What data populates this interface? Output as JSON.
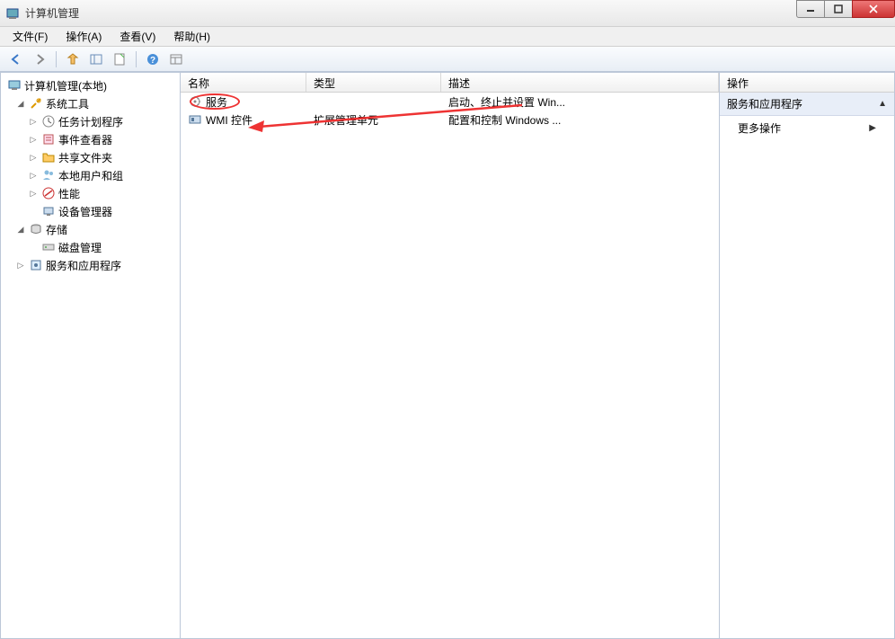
{
  "window": {
    "title": "计算机管理"
  },
  "menu": {
    "file": "文件(F)",
    "action": "操作(A)",
    "view": "查看(V)",
    "help": "帮助(H)"
  },
  "tree": {
    "root": "计算机管理(本地)",
    "system_tools": "系统工具",
    "task_scheduler": "任务计划程序",
    "event_viewer": "事件查看器",
    "shared_folders": "共享文件夹",
    "local_users": "本地用户和组",
    "performance": "性能",
    "device_manager": "设备管理器",
    "storage": "存储",
    "disk_management": "磁盘管理",
    "services_apps": "服务和应用程序"
  },
  "list": {
    "headers": {
      "name": "名称",
      "type": "类型",
      "description": "描述"
    },
    "rows": [
      {
        "name": "服务",
        "type": "",
        "description": "启动、终止并设置 Win..."
      },
      {
        "name": "WMI 控件",
        "type": "扩展管理单元",
        "description": "配置和控制 Windows ..."
      }
    ]
  },
  "actions": {
    "header": "操作",
    "section": "服务和应用程序",
    "more": "更多操作"
  }
}
